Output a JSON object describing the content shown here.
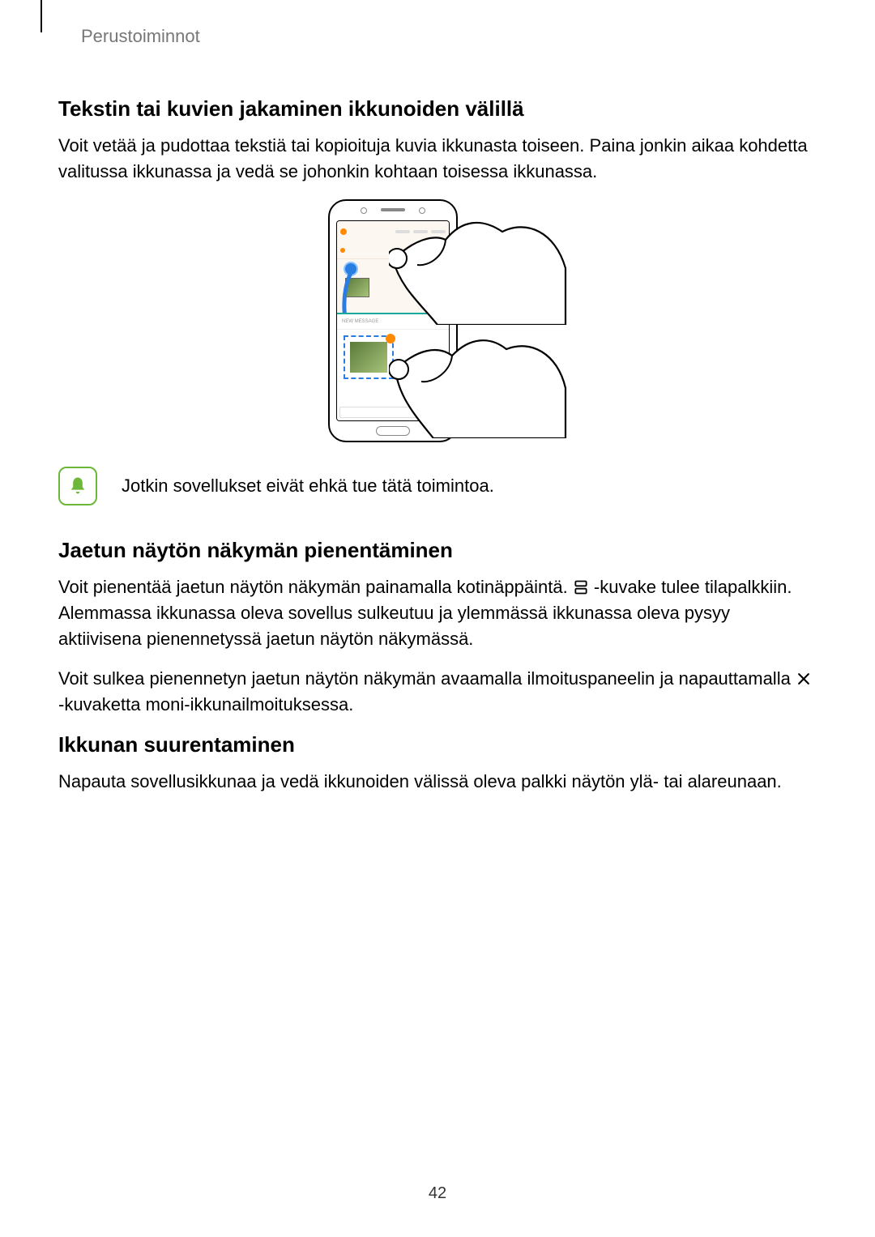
{
  "header": {
    "section": "Perustoiminnot"
  },
  "section1": {
    "heading": "Tekstin tai kuvien jakaminen ikkunoiden välillä",
    "para": "Voit vetää ja pudottaa tekstiä tai kopioituja kuvia ikkunasta toiseen. Paina jonkin aikaa kohdetta valitussa ikkunassa ja vedä se johonkin kohtaan toisessa ikkunassa."
  },
  "figure": {
    "new_message_label": "NEW MESSAGE"
  },
  "note": {
    "text": "Jotkin sovellukset eivät ehkä tue tätä toimintoa."
  },
  "section2": {
    "heading": "Jaetun näytön näkymän pienentäminen",
    "p1a": "Voit pienentää jaetun näytön näkymän painamalla kotinäppäintä. ",
    "p1b": " -kuvake tulee tilapalkkiin. Alemmassa ikkunassa oleva sovellus sulkeutuu ja ylemmässä ikkunassa oleva pysyy aktiivisena pienennetyssä jaetun näytön näkymässä.",
    "p2a": "Voit sulkea pienennetyn jaetun näytön näkymän avaamalla ilmoituspaneelin ja napauttamalla ",
    "p2b": "-kuvaketta moni-ikkunailmoituksessa."
  },
  "section3": {
    "heading": "Ikkunan suurentaminen",
    "para": "Napauta sovellusikkunaa ja vedä ikkunoiden välissä oleva palkki näytön ylä- tai alareunaan."
  },
  "page_number": "42"
}
